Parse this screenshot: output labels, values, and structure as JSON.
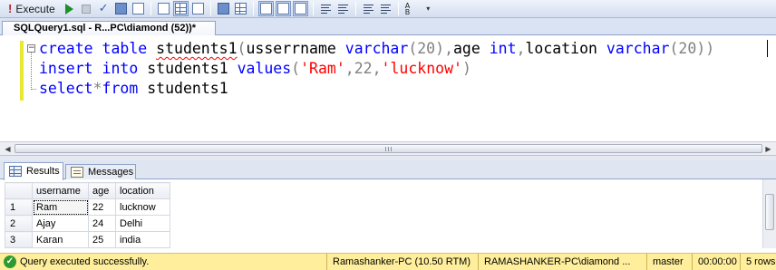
{
  "toolbar": {
    "execute_label": "Execute",
    "icons": [
      "execute-icon",
      "debug-icon",
      "stop-icon",
      "parse-icon",
      "display-plan-icon",
      "query-designer-icon",
      "results-to-text-icon",
      "results-to-grid-icon",
      "results-to-file-icon",
      "include-plan-icon",
      "client-statistics-icon",
      "query-options-icon",
      "comment-icon",
      "uncomment-icon",
      "decrease-indent-icon",
      "increase-indent-icon",
      "specify-values-icon"
    ]
  },
  "document_tab": {
    "title": "SQLQuery1.sql - R...PC\\diamond (52))*"
  },
  "editor": {
    "lines": [
      {
        "parts": [
          {
            "text": "create table ",
            "role": "keyword"
          },
          {
            "text": "students1",
            "role": "ident-error"
          },
          {
            "text": "(",
            "role": "gray"
          },
          {
            "text": "usserrname ",
            "role": "plain"
          },
          {
            "text": "varchar",
            "role": "keyword"
          },
          {
            "text": "(20)",
            "role": "gray"
          },
          {
            "text": ",",
            "role": "gray"
          },
          {
            "text": "age ",
            "role": "plain"
          },
          {
            "text": "int",
            "role": "keyword"
          },
          {
            "text": ",",
            "role": "gray"
          },
          {
            "text": "location ",
            "role": "plain"
          },
          {
            "text": "varchar",
            "role": "keyword"
          },
          {
            "text": "(20))",
            "role": "gray"
          }
        ]
      },
      {
        "parts": [
          {
            "text": "insert into ",
            "role": "keyword"
          },
          {
            "text": "students1 ",
            "role": "plain"
          },
          {
            "text": "values",
            "role": "keyword"
          },
          {
            "text": "(",
            "role": "gray"
          },
          {
            "text": "'Ram'",
            "role": "string"
          },
          {
            "text": ",22,",
            "role": "gray"
          },
          {
            "text": "'lucknow'",
            "role": "string"
          },
          {
            "text": ")",
            "role": "gray"
          }
        ]
      },
      {
        "parts": [
          {
            "text": "select",
            "role": "keyword"
          },
          {
            "text": "*",
            "role": "gray"
          },
          {
            "text": "from ",
            "role": "keyword"
          },
          {
            "text": "students1",
            "role": "plain"
          }
        ]
      }
    ],
    "colors": {
      "keyword": "#0000ff",
      "string": "#ff0000",
      "operator": "#808080",
      "change_marker": "#e8e82e"
    }
  },
  "results_tabs": {
    "results_label": "Results",
    "messages_label": "Messages"
  },
  "grid": {
    "columns": [
      "username",
      "age",
      "location"
    ],
    "rows": [
      {
        "num": "1",
        "username": "Ram",
        "age": "22",
        "location": "lucknow"
      },
      {
        "num": "2",
        "username": "Ajay",
        "age": "24",
        "location": "Delhi"
      },
      {
        "num": "3",
        "username": "Karan",
        "age": "25",
        "location": "india"
      }
    ]
  },
  "status": {
    "message": "Query executed successfully.",
    "server": "Ramashanker-PC (10.50 RTM)",
    "login": "RAMASHANKER-PC\\diamond ...",
    "database": "master",
    "elapsed": "00:00:00",
    "rows": "5 rows",
    "bar_color": "#ffef9c"
  }
}
